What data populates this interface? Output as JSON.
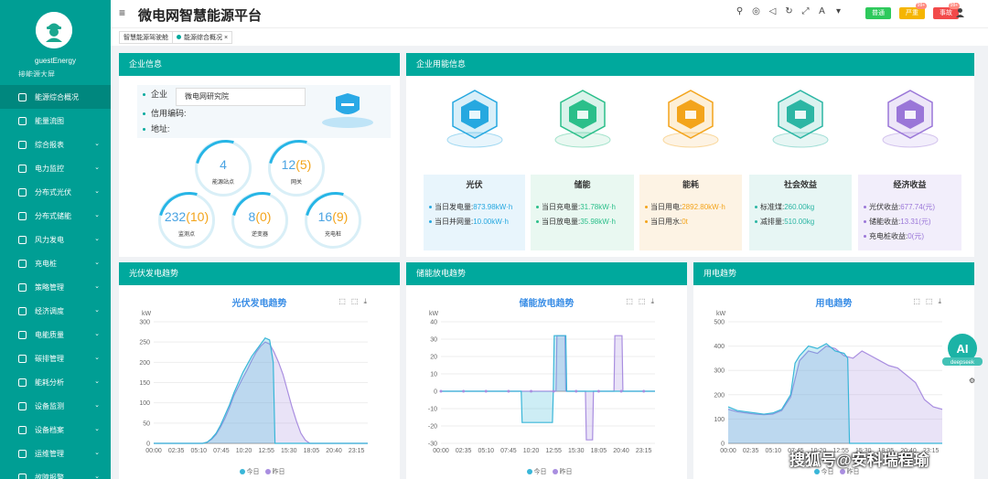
{
  "app": {
    "title": "微电网智慧能源平台"
  },
  "user": {
    "name": "guestEnergy"
  },
  "sidebar": {
    "cut_item": "接能源大屏",
    "items": [
      {
        "label": "能源综合概况",
        "chevron": ""
      },
      {
        "label": "能量流图",
        "chevron": ""
      },
      {
        "label": "综合报表",
        "chevron": "⌄"
      },
      {
        "label": "电力监控",
        "chevron": "⌄"
      },
      {
        "label": "分布式光伏",
        "chevron": "⌄"
      },
      {
        "label": "分布式储能",
        "chevron": "⌄"
      },
      {
        "label": "风力发电",
        "chevron": "⌄"
      },
      {
        "label": "充电桩",
        "chevron": "⌄"
      },
      {
        "label": "策略管理",
        "chevron": "⌄"
      },
      {
        "label": "经济调度",
        "chevron": "⌄"
      },
      {
        "label": "电能质量",
        "chevron": "⌄"
      },
      {
        "label": "碳排管理",
        "chevron": "⌄"
      },
      {
        "label": "能耗分析",
        "chevron": "⌄"
      },
      {
        "label": "设备监测",
        "chevron": "⌄"
      },
      {
        "label": "设备档案",
        "chevron": "⌄"
      },
      {
        "label": "运维管理",
        "chevron": "⌄"
      },
      {
        "label": "故障报警",
        "chevron": "⌄"
      }
    ]
  },
  "topbar": {
    "badges": [
      {
        "label": "普通",
        "color": "#2ec95c",
        "count": ""
      },
      {
        "label": "严重",
        "color": "#f5b500",
        "count": "99+"
      },
      {
        "label": "事故",
        "color": "#f24a4a",
        "count": "99+"
      }
    ]
  },
  "tabs": [
    {
      "label": "智慧能源驾驶舱"
    },
    {
      "label": "能源综合概况",
      "close": "×"
    }
  ],
  "enterprise": {
    "header": "企业信息",
    "fields": [
      {
        "label": "企业",
        "value": "微电网研究院"
      },
      {
        "label": "信用编码:",
        "value": ""
      },
      {
        "label": "地址:",
        "value": ""
      }
    ],
    "stats": [
      {
        "value": "4",
        "extra": "",
        "label": "能源站点"
      },
      {
        "value": "12",
        "extra": "(5)",
        "label": "网关"
      },
      {
        "value": "232",
        "extra": "(10)",
        "label": "监测点"
      },
      {
        "value": "8",
        "extra": "(0)",
        "label": "逆变器"
      },
      {
        "value": "16",
        "extra": "(9)",
        "label": "充电桩"
      }
    ]
  },
  "usage": {
    "header": "企业用能信息",
    "categories": [
      {
        "title": "光伏",
        "color": "#26a8e0",
        "bg": "#e8f5fc",
        "rows": [
          {
            "label": "当日发电量:",
            "value": "873.98kW·h"
          },
          {
            "label": "当日并网量:",
            "value": "10.00kW·h"
          }
        ]
      },
      {
        "title": "储能",
        "color": "#2bbf8a",
        "bg": "#e9f8f1",
        "rows": [
          {
            "label": "当日充电量:",
            "value": "31.78kW·h"
          },
          {
            "label": "当日放电量:",
            "value": "35.98kW·h"
          }
        ]
      },
      {
        "title": "能耗",
        "color": "#f3a41b",
        "bg": "#fdf3e4",
        "rows": [
          {
            "label": "当日用电:",
            "value": "2892.80kW·h"
          },
          {
            "label": "当日用水:",
            "value": "0t"
          }
        ]
      },
      {
        "title": "社会效益",
        "color": "#2cb6a4",
        "bg": "#e7f6f4",
        "rows": [
          {
            "label": "标准煤:",
            "value": "260.00kg"
          },
          {
            "label": "减排量:",
            "value": "510.00kg"
          }
        ]
      },
      {
        "title": "经济收益",
        "color": "#9a76d8",
        "bg": "#f2eefb",
        "rows": [
          {
            "label": "光伏收益:",
            "value": "677.74(元)"
          },
          {
            "label": "储能收益:",
            "value": "13.31(元)"
          },
          {
            "label": "充电桩收益:",
            "value": "0(元)"
          }
        ]
      }
    ]
  },
  "chart_data": [
    {
      "panel_header": "光伏发电趋势",
      "type": "area",
      "title": "光伏发电趋势",
      "ylabel": "kW",
      "ylim": [
        0,
        300
      ],
      "yticks": [
        0,
        50,
        100,
        150,
        200,
        250,
        300
      ],
      "xticks": [
        "00:00",
        "02:35",
        "05:10",
        "07:45",
        "10:20",
        "12:55",
        "15:30",
        "18:05",
        "20:40",
        "23:15"
      ],
      "xdomain": [
        0,
        24
      ],
      "legend": [
        "今日",
        "昨日"
      ],
      "series": [
        {
          "name": "今日",
          "color": "#39b6d8",
          "points": [
            [
              0,
              0
            ],
            [
              5.5,
              0
            ],
            [
              6,
              3
            ],
            [
              6.5,
              12
            ],
            [
              7,
              25
            ],
            [
              7.5,
              45
            ],
            [
              8,
              70
            ],
            [
              8.5,
              95
            ],
            [
              9,
              125
            ],
            [
              9.5,
              150
            ],
            [
              10,
              175
            ],
            [
              10.5,
              195
            ],
            [
              11,
              215
            ],
            [
              11.5,
              230
            ],
            [
              12,
              245
            ],
            [
              12.5,
              260
            ],
            [
              13,
              255
            ],
            [
              13.4,
              200
            ],
            [
              13.6,
              0
            ],
            [
              24,
              0
            ]
          ]
        },
        {
          "name": "昨日",
          "color": "#a98ee0",
          "points": [
            [
              0,
              0
            ],
            [
              5.5,
              0
            ],
            [
              6,
              3
            ],
            [
              6.5,
              10
            ],
            [
              7,
              22
            ],
            [
              7.5,
              40
            ],
            [
              8,
              62
            ],
            [
              8.5,
              88
            ],
            [
              9,
              118
            ],
            [
              9.5,
              140
            ],
            [
              10,
              162
            ],
            [
              10.5,
              182
            ],
            [
              11,
              205
            ],
            [
              11.5,
              225
            ],
            [
              12,
              240
            ],
            [
              12.5,
              250
            ],
            [
              13,
              245
            ],
            [
              13.5,
              225
            ],
            [
              14,
              200
            ],
            [
              14.5,
              170
            ],
            [
              15,
              130
            ],
            [
              15.5,
              90
            ],
            [
              16,
              55
            ],
            [
              16.5,
              25
            ],
            [
              17,
              8
            ],
            [
              17.5,
              0
            ],
            [
              24,
              0
            ]
          ]
        }
      ]
    },
    {
      "panel_header": "储能放电趋势",
      "type": "area",
      "title": "储能放电趋势",
      "ylabel": "kW",
      "ylim": [
        -30,
        40
      ],
      "yticks": [
        -30,
        -20,
        -10,
        0,
        10,
        20,
        30,
        40
      ],
      "xticks": [
        "00:00",
        "02:35",
        "05:10",
        "07:45",
        "10:20",
        "12:55",
        "15:30",
        "18:05",
        "20:40",
        "23:15"
      ],
      "xdomain": [
        0,
        24
      ],
      "legend": [
        "今日",
        "昨日"
      ],
      "series": [
        {
          "name": "今日",
          "color": "#39b6d8",
          "points": [
            [
              0,
              0
            ],
            [
              9,
              0
            ],
            [
              9.1,
              -18
            ],
            [
              12.5,
              -18
            ],
            [
              12.6,
              0
            ],
            [
              12.7,
              32
            ],
            [
              14,
              32
            ],
            [
              14.1,
              0
            ],
            [
              24,
              0
            ]
          ]
        },
        {
          "name": "昨日",
          "color": "#a98ee0",
          "points": [
            [
              0,
              0
            ],
            [
              12.9,
              0
            ],
            [
              13,
              32
            ],
            [
              13.9,
              32
            ],
            [
              14,
              0
            ],
            [
              16.2,
              0
            ],
            [
              16.3,
              -28
            ],
            [
              17,
              -28
            ],
            [
              17.1,
              0
            ],
            [
              19.4,
              0
            ],
            [
              19.5,
              32
            ],
            [
              20.3,
              32
            ],
            [
              20.4,
              0
            ],
            [
              24,
              0
            ]
          ]
        }
      ]
    },
    {
      "panel_header": "用电趋势",
      "type": "area",
      "title": "用电趋势",
      "ylabel": "kW",
      "ylim": [
        0,
        500
      ],
      "yticks": [
        0,
        100,
        200,
        300,
        400,
        500
      ],
      "xticks": [
        "00:00",
        "02:35",
        "05:10",
        "07:45",
        "10:20",
        "12:55",
        "15:30",
        "18:05",
        "20:40",
        "23:15"
      ],
      "xdomain": [
        0,
        24
      ],
      "legend": [
        "今日",
        "昨日"
      ],
      "series": [
        {
          "name": "今日",
          "color": "#39b6d8",
          "points": [
            [
              0,
              150
            ],
            [
              1,
              135
            ],
            [
              2,
              130
            ],
            [
              3,
              125
            ],
            [
              4,
              120
            ],
            [
              5,
              125
            ],
            [
              6,
              140
            ],
            [
              7,
              200
            ],
            [
              7.5,
              330
            ],
            [
              8,
              360
            ],
            [
              9,
              400
            ],
            [
              10,
              390
            ],
            [
              11,
              410
            ],
            [
              12,
              380
            ],
            [
              13,
              370
            ],
            [
              13.4,
              350
            ],
            [
              13.6,
              0
            ],
            [
              24,
              0
            ]
          ]
        },
        {
          "name": "昨日",
          "color": "#a98ee0",
          "points": [
            [
              0,
              140
            ],
            [
              1,
              130
            ],
            [
              2,
              125
            ],
            [
              3,
              120
            ],
            [
              4,
              118
            ],
            [
              5,
              120
            ],
            [
              6,
              135
            ],
            [
              7,
              190
            ],
            [
              8,
              340
            ],
            [
              9,
              380
            ],
            [
              10,
              370
            ],
            [
              11,
              400
            ],
            [
              12,
              390
            ],
            [
              13,
              360
            ],
            [
              14,
              350
            ],
            [
              15,
              380
            ],
            [
              16,
              360
            ],
            [
              17,
              340
            ],
            [
              18,
              320
            ],
            [
              19,
              310
            ],
            [
              20,
              280
            ],
            [
              21,
              250
            ],
            [
              22,
              180
            ],
            [
              23,
              150
            ],
            [
              24,
              140
            ]
          ]
        }
      ]
    }
  ],
  "ai": {
    "label": "AI",
    "sub": "deepseek"
  },
  "watermark": "搜狐号@安科瑞程瑜"
}
